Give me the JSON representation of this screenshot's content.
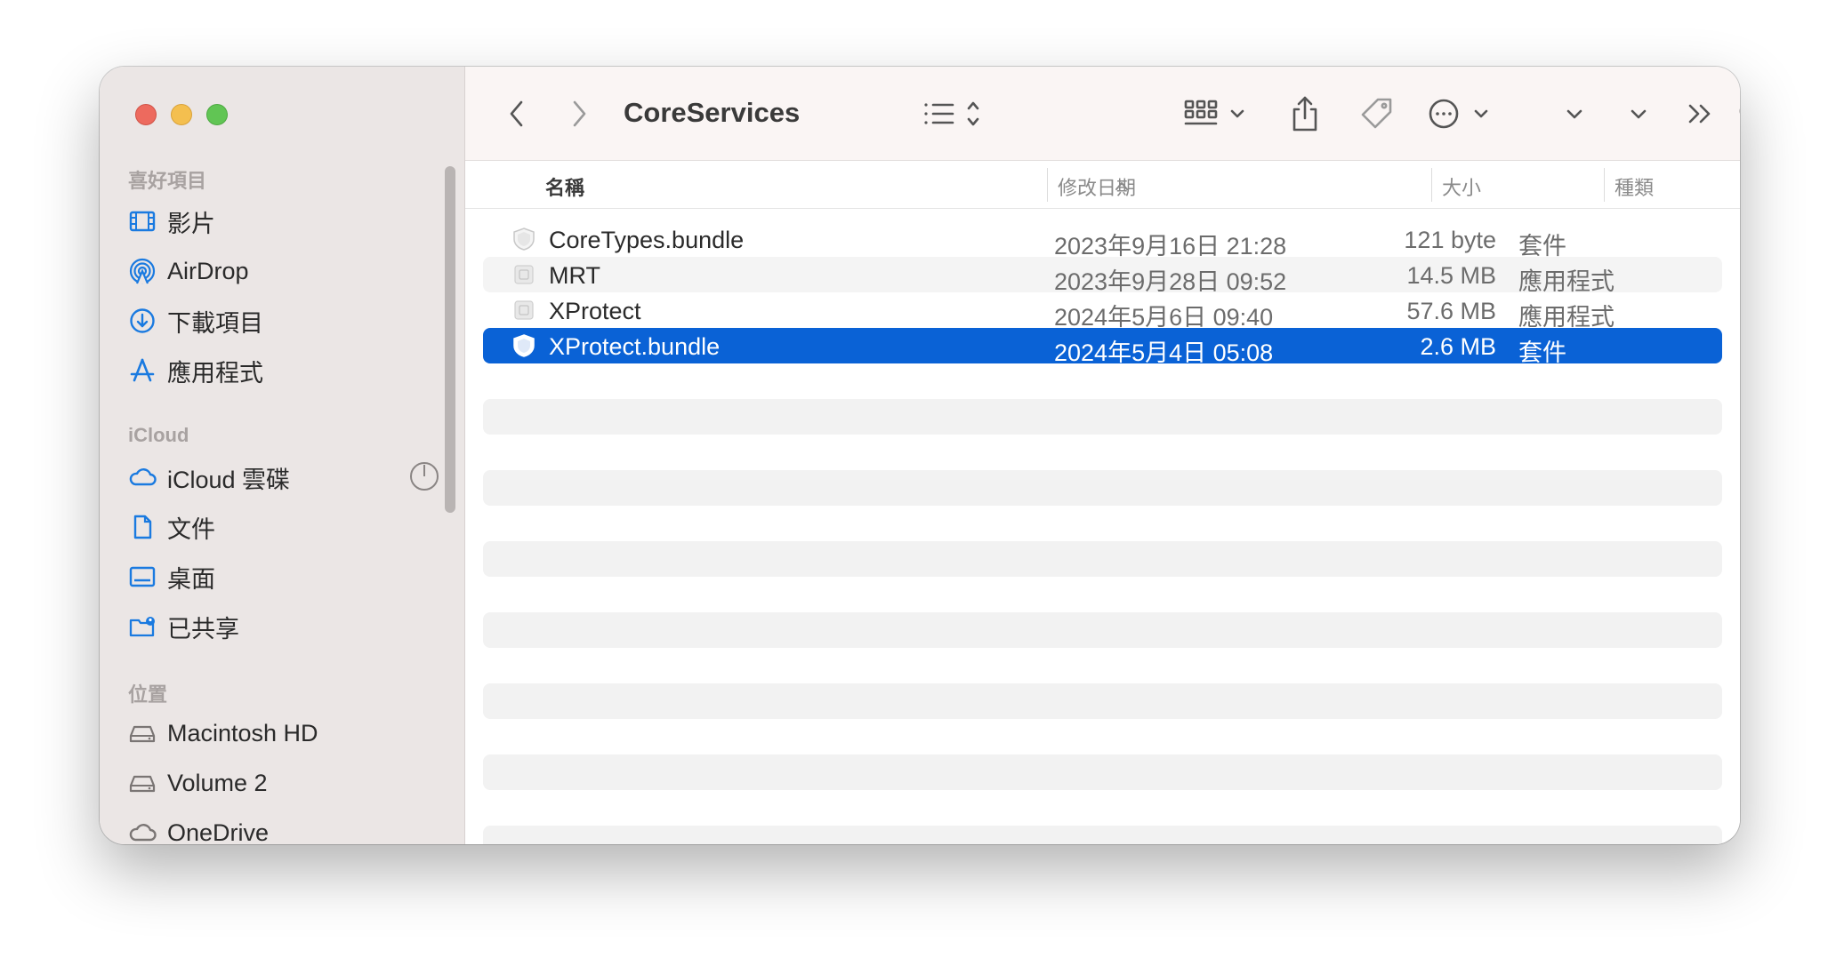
{
  "window": {
    "title": "CoreServices"
  },
  "sidebar": {
    "sections": [
      {
        "title": "喜好項目",
        "items": [
          {
            "label": "影片",
            "icon": "film-icon"
          },
          {
            "label": "AirDrop",
            "icon": "airdrop-icon"
          },
          {
            "label": "下載項目",
            "icon": "download-icon"
          },
          {
            "label": "應用程式",
            "icon": "applications-icon"
          }
        ]
      },
      {
        "title": "iCloud",
        "items": [
          {
            "label": "iCloud 雲碟",
            "icon": "cloud-icon"
          },
          {
            "label": "文件",
            "icon": "document-icon"
          },
          {
            "label": "桌面",
            "icon": "desktop-icon"
          },
          {
            "label": "已共享",
            "icon": "shared-folder-icon"
          }
        ]
      },
      {
        "title": "位置",
        "items": [
          {
            "label": "Macintosh HD",
            "icon": "disk-icon"
          },
          {
            "label": "Volume 2",
            "icon": "disk-icon"
          },
          {
            "label": "OneDrive",
            "icon": "cloud-icon"
          }
        ]
      }
    ]
  },
  "toolbar": {
    "back_icon": "chevron-left-icon",
    "forward_icon": "chevron-right-icon",
    "view_list_icon": "list-view-icon",
    "group_icon": "grid-icon",
    "share_icon": "share-icon",
    "tag_icon": "tag-icon",
    "more_icon": "ellipsis-circle-icon",
    "overflow_icon": "double-chevron-icon",
    "search_icon": "search-icon"
  },
  "columns": {
    "name": "名稱",
    "date": "修改日期",
    "size": "大小",
    "kind": "種類"
  },
  "files": [
    {
      "name": "CoreTypes.bundle",
      "date": "2023年9月16日 21:28",
      "size": "121 byte",
      "kind": "套件",
      "icon": "shield-bundle-icon",
      "selected": false
    },
    {
      "name": "MRT",
      "date": "2023年9月28日 09:52",
      "size": "14.5 MB",
      "kind": "應用程式",
      "icon": "app-icon",
      "selected": false
    },
    {
      "name": "XProtect",
      "date": "2024年5月6日 09:40",
      "size": "57.6 MB",
      "kind": "應用程式",
      "icon": "app-icon",
      "selected": false
    },
    {
      "name": "XProtect.bundle",
      "date": "2024年5月4日 05:08",
      "size": "2.6 MB",
      "kind": "套件",
      "icon": "shield-bundle-icon",
      "selected": true
    }
  ],
  "colors": {
    "selection": "#0a62d6",
    "sidebar_accent": "#1a7ae0"
  }
}
